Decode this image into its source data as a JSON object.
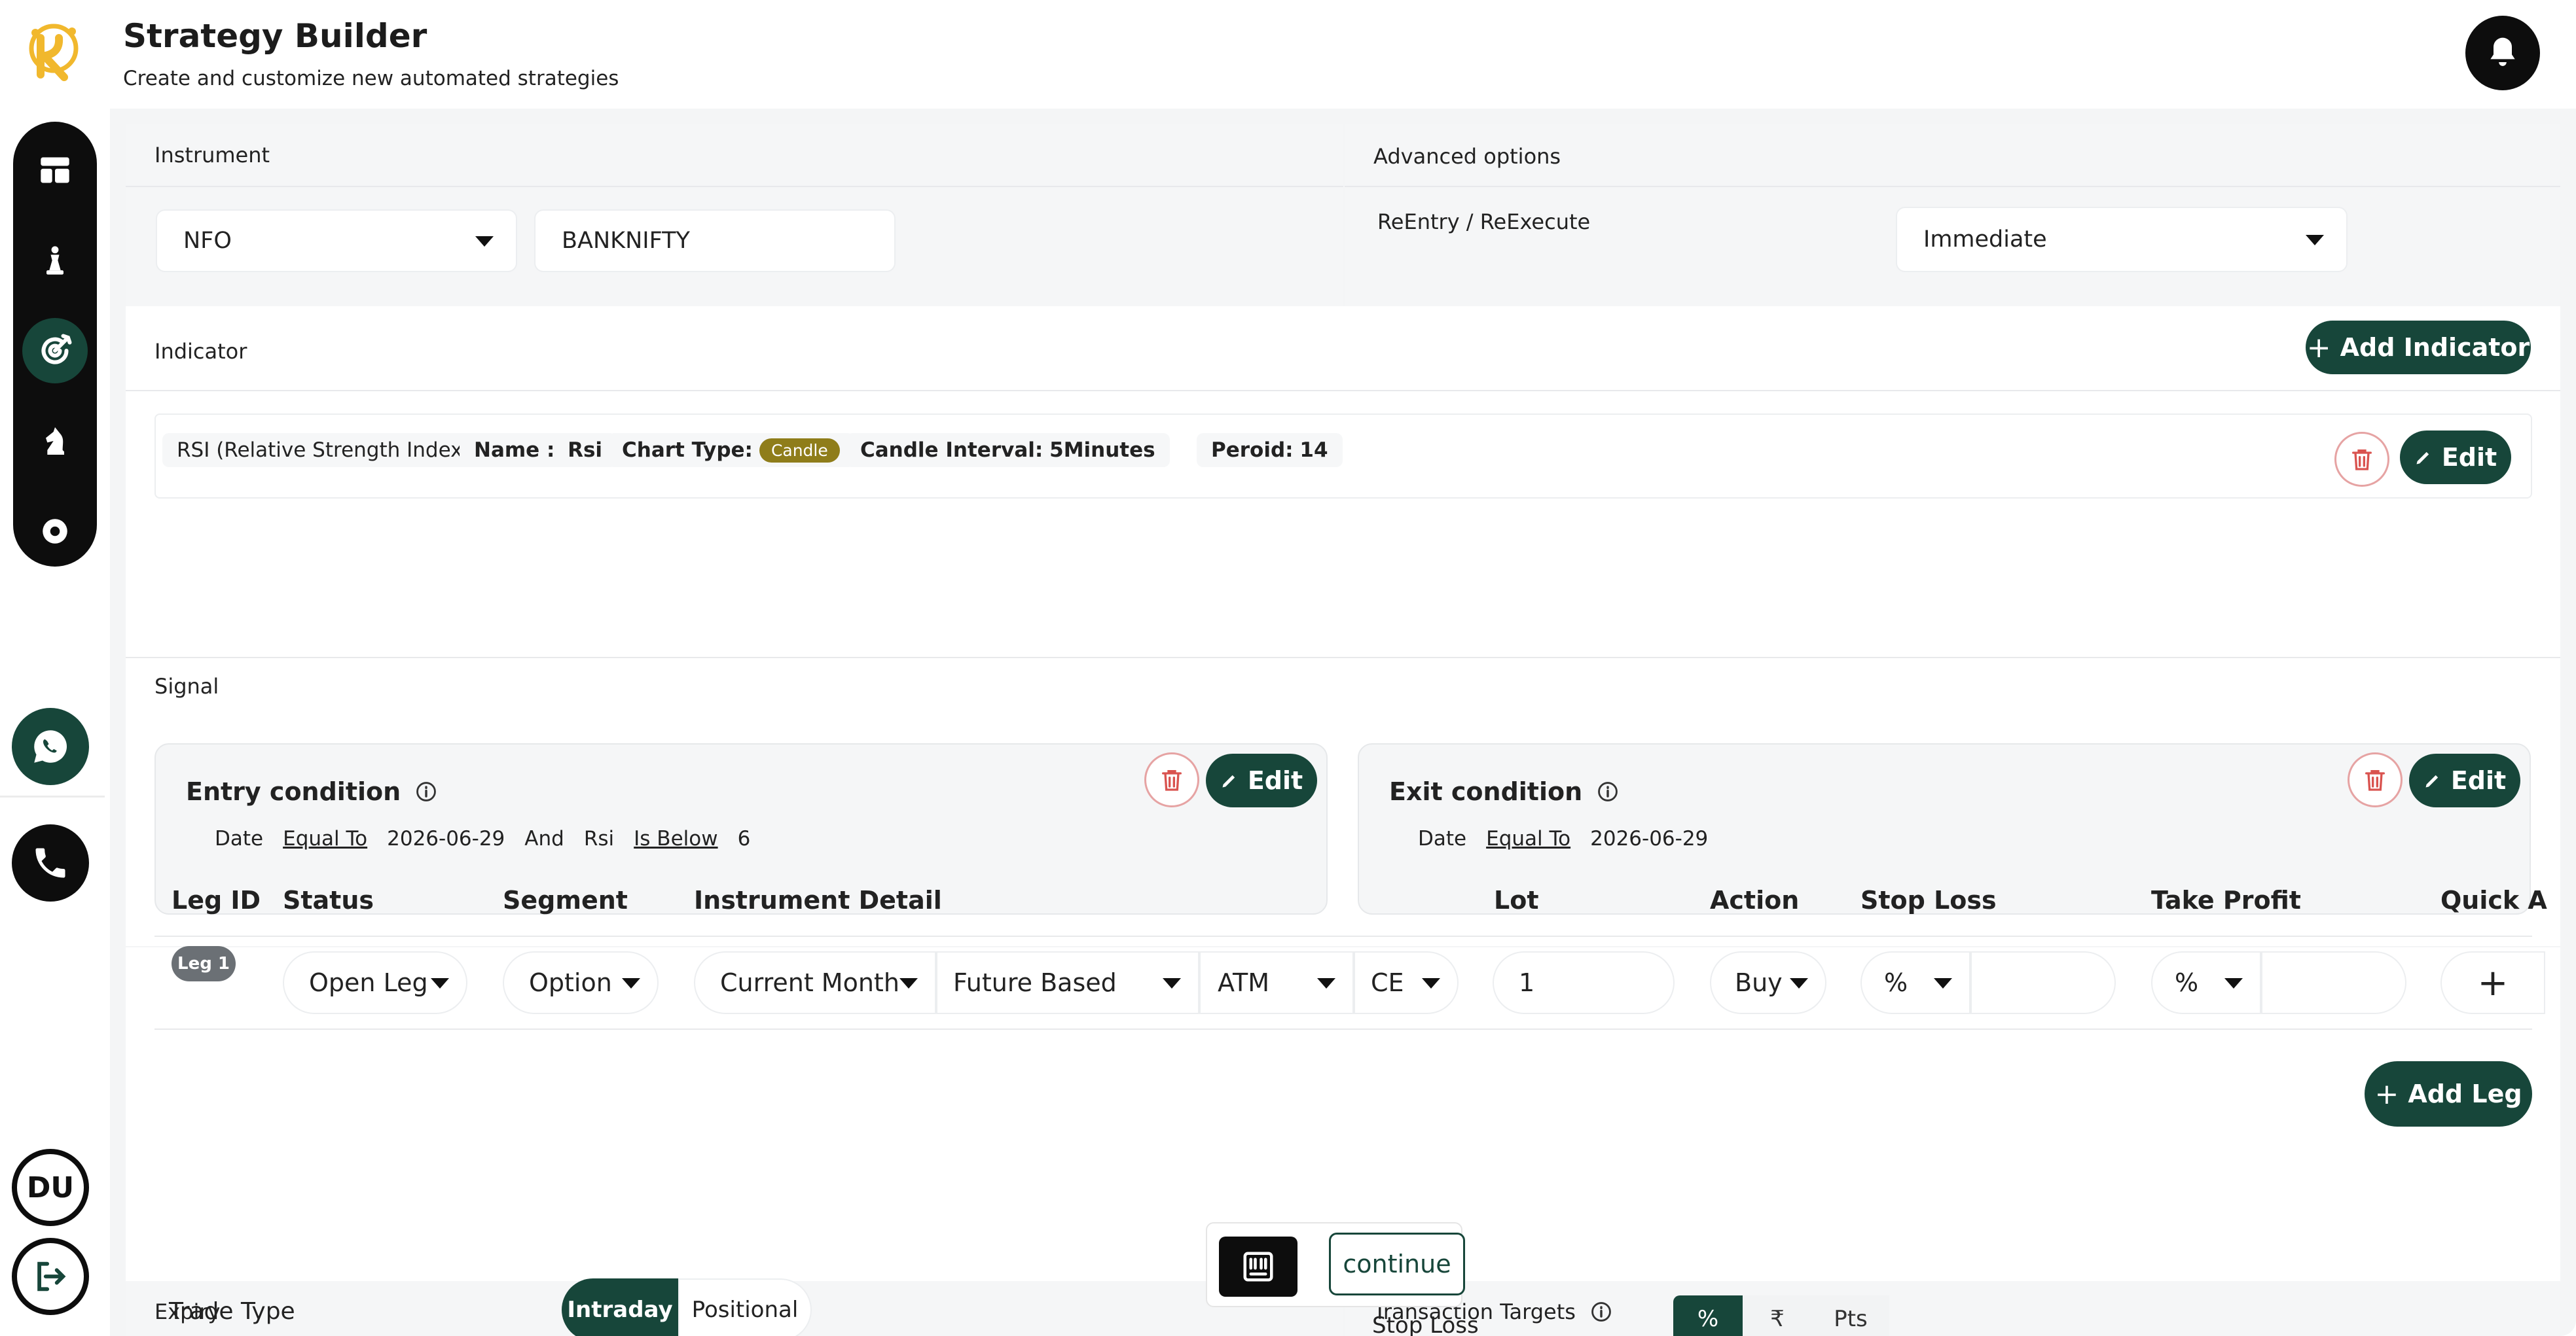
{
  "header": {
    "title": "Strategy Builder",
    "subtitle": "Create and customize new automated strategies"
  },
  "sidebar": {
    "avatar_initials": "DU"
  },
  "instrument": {
    "label": "Instrument",
    "exchange": "NFO",
    "symbol": "BANKNIFTY"
  },
  "advanced": {
    "label": "Advanced options",
    "reentry_label": "ReEntry / ReExecute",
    "reentry_value": "Immediate"
  },
  "indicator": {
    "label": "Indicator",
    "add_label": "Add Indicator",
    "item": {
      "full_name": "RSI (Relative Strength Index)",
      "name_label": "Name :",
      "name_value": "Rsi",
      "chart_type_label": "Chart Type:",
      "chart_type_value": "Candle",
      "interval_label": "Candle Interval:",
      "interval_value": "5Minutes",
      "period_label": "Peroid:",
      "period_value": "14",
      "edit_label": "Edit"
    }
  },
  "signal": {
    "label": "Signal",
    "entry": {
      "title": "Entry condition",
      "edit_label": "Edit",
      "parts": [
        "Date",
        "Equal To",
        "2026-06-29",
        "And",
        "Rsi",
        "Is Below",
        "6"
      ]
    },
    "exit": {
      "title": "Exit condition",
      "edit_label": "Edit",
      "parts": [
        "Date",
        "Equal To",
        "2026-06-29"
      ]
    }
  },
  "legs": {
    "columns": [
      "Leg ID",
      "Status",
      "Segment",
      "Instrument Detail",
      "Lot",
      "Action",
      "Stop Loss",
      "Take Profit",
      "Quick A"
    ],
    "row": {
      "leg_id": "Leg 1",
      "status": "Open Leg",
      "segment": "Option",
      "expiry": "Current Month",
      "strike_basis": "Future Based",
      "strike": "ATM",
      "option_type": "CE",
      "lot": "1",
      "action": "Buy",
      "stop_loss_unit": "%",
      "take_profit_unit": "%"
    },
    "add_label": "Add Leg"
  },
  "expiry": {
    "label": "Expiry",
    "trade_type_label": "Trade Type",
    "trade_types": [
      "Intraday",
      "Positional"
    ],
    "selected": "Intraday"
  },
  "targets": {
    "label": "Transaction Targets",
    "stop_loss_label": "Stop Loss",
    "units": [
      "%",
      "₹",
      "Pts"
    ]
  },
  "floating": {
    "continue_label": "continue"
  },
  "colors": {
    "accent": "#17463a",
    "dark": "#0d0d0d",
    "candle_badge": "#8f7d1a",
    "danger": "#d9534f"
  }
}
